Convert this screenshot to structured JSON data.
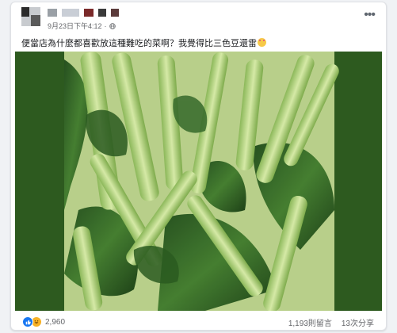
{
  "post": {
    "timestamp": "9月23日下午4:12",
    "separator": "·",
    "more_label": "•••",
    "text": "便當店為什麼都喜歡放這種難吃的菜啊？我覺得比三色豆還雷"
  },
  "colors": {
    "media_bg": "#2d5a1f",
    "like_blue": "#1877f2",
    "haha_yellow": "#f7b125"
  },
  "footer": {
    "reaction_count": "2,960",
    "comments": "1,193則留言",
    "shares": "13次分享"
  },
  "icons": [
    "globe-icon",
    "more-icon",
    "like-reaction-icon",
    "haha-reaction-icon",
    "emoji-icon"
  ]
}
